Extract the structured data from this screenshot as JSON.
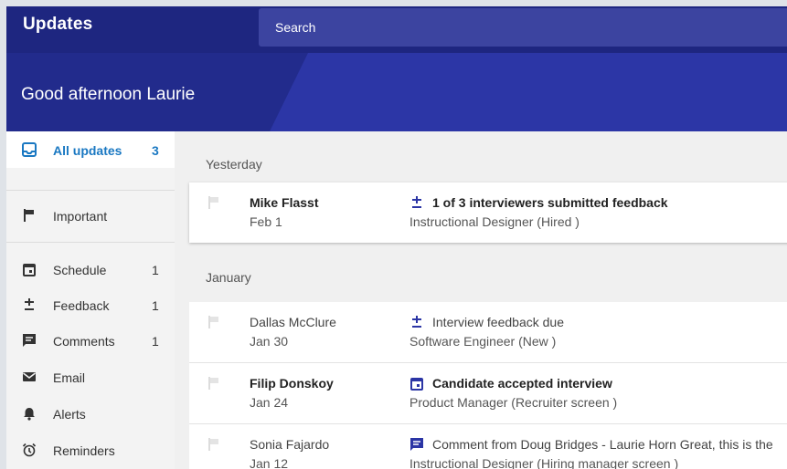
{
  "header": {
    "app_title": "Updates",
    "search_placeholder": "Search"
  },
  "hero": {
    "greeting": "Good afternoon Laurie"
  },
  "colors": {
    "topbar": "#1e2680",
    "hero": "#222b8c",
    "accent": "#1a78c2",
    "event_icon": "#2b35a5"
  },
  "sidebar": {
    "items": [
      {
        "label": "All updates",
        "count": "3",
        "icon": "inbox-icon",
        "active": true
      },
      {
        "label": "Important",
        "count": "",
        "icon": "flag-icon"
      },
      {
        "label": "Schedule",
        "count": "1",
        "icon": "calendar-icon"
      },
      {
        "label": "Feedback",
        "count": "1",
        "icon": "plus-minus-icon"
      },
      {
        "label": "Comments",
        "count": "1",
        "icon": "comment-icon"
      },
      {
        "label": "Email",
        "count": "",
        "icon": "mail-icon"
      },
      {
        "label": "Alerts",
        "count": "",
        "icon": "bell-icon"
      },
      {
        "label": "Reminders",
        "count": "",
        "icon": "alarm-clock-icon"
      }
    ]
  },
  "feed": {
    "groups": [
      {
        "heading": "Yesterday",
        "items": [
          {
            "name": "Mike Flasst",
            "date": "Feb 1",
            "event": "1 of 3 interviewers submitted feedback",
            "event_icon": "plus-minus-icon",
            "role": "Instructional Designer (Hired )",
            "unread": true
          }
        ]
      },
      {
        "heading": "January",
        "items": [
          {
            "name": "Dallas McClure",
            "date": "Jan 30",
            "event": "Interview feedback due",
            "event_icon": "plus-minus-icon",
            "role": "Software Engineer (New )",
            "unread": false
          },
          {
            "name": "Filip Donskoy",
            "date": "Jan 24",
            "event": "Candidate accepted interview",
            "event_icon": "calendar-icon",
            "role": "Product Manager (Recruiter screen )",
            "unread": true
          },
          {
            "name": "Sonia Fajardo",
            "date": "Jan 12",
            "event": "Comment from Doug Bridges - Laurie Horn Great, this is the",
            "event_icon": "comment-icon",
            "role": "Instructional Designer (Hiring manager screen )",
            "unread": false
          }
        ]
      }
    ]
  }
}
